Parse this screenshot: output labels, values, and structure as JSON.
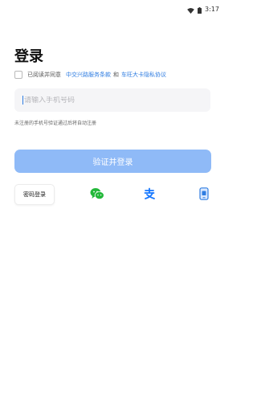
{
  "status_bar": {
    "time": "3:17",
    "icons": [
      "wifi-icon",
      "battery-icon"
    ]
  },
  "title": "登录",
  "agreement": {
    "prefix": "已阅读并同意",
    "terms_link": "中交兴路服务条款",
    "joiner": "和",
    "privacy_link": "车旺大卡隐私协议"
  },
  "phone": {
    "placeholder": "请输入手机号码",
    "value": ""
  },
  "hint": "未注册的手机号验证通过后将自动注册",
  "login_button": "验证并登录",
  "alt_login": {
    "password_label": "密码登录",
    "icons": [
      "wechat-icon",
      "alipay-icon",
      "phone-device-icon"
    ]
  },
  "colors": {
    "accent": "#2f7de1",
    "button_bg": "#8fbaf7",
    "wechat": "#23b83a",
    "alipay": "#1677ff"
  }
}
